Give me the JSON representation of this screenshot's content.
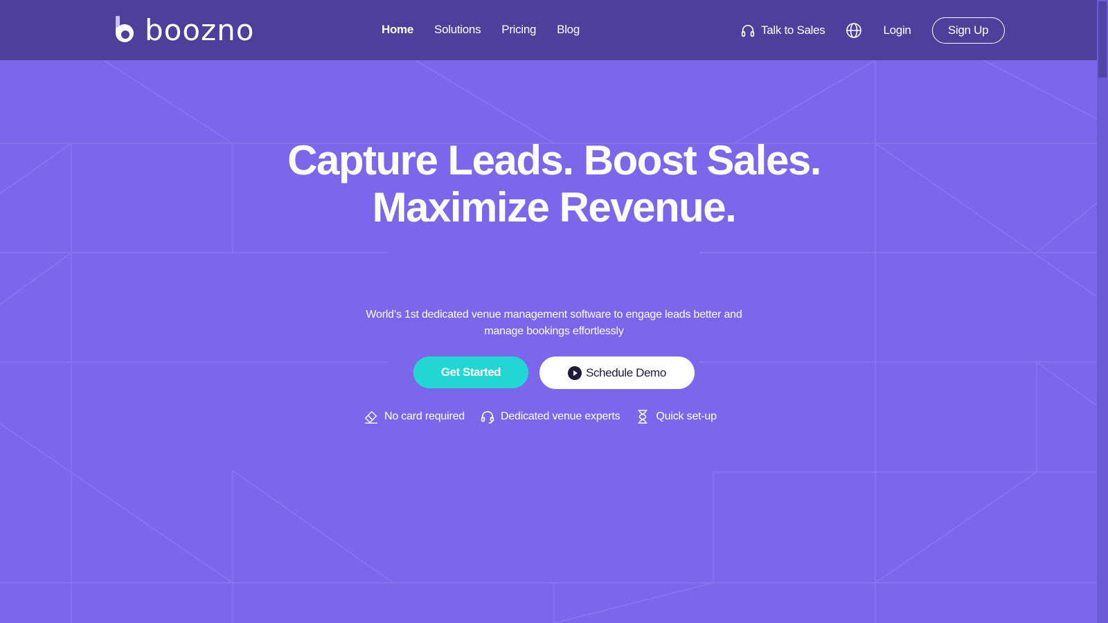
{
  "brand": {
    "name": "boozno"
  },
  "nav": {
    "items": [
      {
        "label": "Home",
        "active": true
      },
      {
        "label": "Solutions",
        "active": false
      },
      {
        "label": "Pricing",
        "active": false
      },
      {
        "label": "Blog",
        "active": false
      }
    ],
    "talk_to_sales": "Talk to Sales",
    "login": "Login",
    "signup": "Sign Up"
  },
  "hero": {
    "headline_line1": "Capture Leads. Boost Sales.",
    "headline_line2": "Maximize Revenue.",
    "subtitle_line1": "World’s 1st dedicated venue management software to engage leads better and",
    "subtitle_line2": "manage bookings effortlessly",
    "primary_cta": "Get Started",
    "secondary_cta": "Schedule Demo",
    "features": [
      {
        "icon": "card-icon",
        "label": "No card required"
      },
      {
        "icon": "headset-icon",
        "label": "Dedicated venue experts"
      },
      {
        "icon": "hourglass-icon",
        "label": "Quick set-up"
      }
    ]
  },
  "colors": {
    "header_bg": "#4e3f9b",
    "hero_bg": "#7c67ec",
    "primary_cta_bg": "#22d6d3",
    "secondary_cta_bg": "#ffffff"
  }
}
